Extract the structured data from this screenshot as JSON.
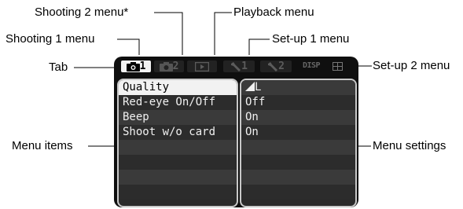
{
  "callouts": {
    "shooting2": "Shooting 2 menu*",
    "playback": "Playback menu",
    "shooting1": "Shooting 1 menu",
    "setup1": "Set-up 1 menu",
    "tab": "Tab",
    "setup2": "Set-up 2 menu",
    "menu_items": "Menu items",
    "menu_settings": "Menu settings"
  },
  "screen": {
    "tabs": [
      {
        "label": "1",
        "icon": "camera-icon",
        "active": true
      },
      {
        "label": "2",
        "icon": "camera-icon",
        "active": false
      },
      {
        "label": "",
        "icon": "playback-icon",
        "active": false
      },
      {
        "label": "1",
        "icon": "wrench-icon",
        "active": false
      },
      {
        "label": "2",
        "icon": "wrench-icon",
        "active": false
      }
    ],
    "disp_label": "DISP",
    "grid_icon": "grid-icon",
    "menu_items": [
      "Quality",
      "Red-eye On/Off",
      "Beep",
      "Shoot w/o card",
      "",
      "",
      "",
      ""
    ],
    "menu_settings": [
      "L",
      "Off",
      "On",
      "On",
      "",
      "",
      "",
      ""
    ],
    "quality_icon": "fine-quality-icon"
  }
}
